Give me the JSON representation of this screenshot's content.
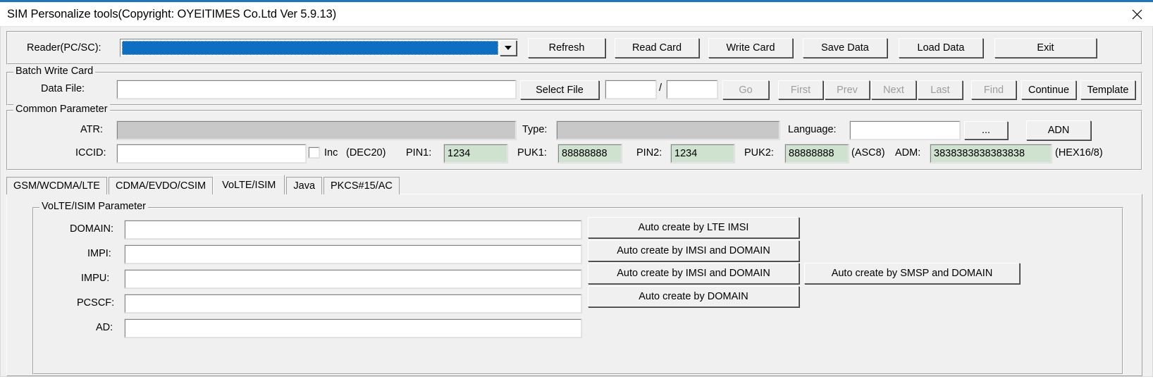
{
  "window": {
    "title": "SIM Personalize tools(Copyright: OYEITIMES Co.Ltd  Ver 5.9.13)",
    "close_icon": "close-icon",
    "accent_color": "#1a78c2",
    "face_color": "#f0f0f0"
  },
  "reader": {
    "label": "Reader(PC/SC):",
    "value": "",
    "dropdown_icon": "chevron-down-icon",
    "selected_color": "#0d6fc4",
    "buttons": [
      {
        "label": "Refresh",
        "enabled": true
      },
      {
        "label": "Read Card",
        "enabled": true
      },
      {
        "label": "Write Card",
        "enabled": true
      },
      {
        "label": "Save Data",
        "enabled": true
      },
      {
        "label": "Load Data",
        "enabled": true
      },
      {
        "label": "Exit",
        "enabled": true
      }
    ]
  },
  "batch": {
    "group_title": "Batch Write Card",
    "data_file_label": "Data File:",
    "data_file_value": "",
    "select_file_label": "Select File",
    "index_current": "",
    "index_separator": "/",
    "index_total": "",
    "nav_buttons": [
      {
        "label": "Go",
        "enabled": false
      },
      {
        "label": "First",
        "enabled": false
      },
      {
        "label": "Prev",
        "enabled": false
      },
      {
        "label": "Next",
        "enabled": false
      },
      {
        "label": "Last",
        "enabled": false
      },
      {
        "label": "Find",
        "enabled": false
      },
      {
        "label": "Continue",
        "enabled": true
      },
      {
        "label": "Template",
        "enabled": true
      }
    ]
  },
  "common": {
    "group_title": "Common Parameter",
    "atr_label": "ATR:",
    "atr_value": "",
    "type_label": "Type:",
    "type_value": "",
    "language_label": "Language:",
    "language_value": "",
    "language_browse_label": "...",
    "adn_label": "ADN",
    "iccid_label": "ICCID:",
    "iccid_value": "",
    "inc_label": "Inc",
    "inc_checked": false,
    "dec20_label": "(DEC20)",
    "pin1_label": "PIN1:",
    "pin1_value": "1234",
    "puk1_label": "PUK1:",
    "puk1_value": "88888888",
    "pin2_label": "PIN2:",
    "pin2_value": "1234",
    "puk2_label": "PUK2:",
    "puk2_value": "88888888",
    "asc8_label": "(ASC8)",
    "adm_label": "ADM:",
    "adm_value": "3838383838383838",
    "hex_label": "(HEX16/8)",
    "value_field_color": "#cfe2cf",
    "readonly_field_color": "#c8c8c8"
  },
  "tabs": [
    {
      "label": "GSM/WCDMA/LTE",
      "active": false
    },
    {
      "label": "CDMA/EVDO/CSIM",
      "active": false
    },
    {
      "label": "VoLTE/ISIM",
      "active": true
    },
    {
      "label": "Java",
      "active": false
    },
    {
      "label": "PKCS#15/AC",
      "active": false
    }
  ],
  "volte": {
    "group_title": "VoLTE/ISIM  Parameter",
    "fields": [
      {
        "label": "DOMAIN:",
        "value": ""
      },
      {
        "label": "IMPI:",
        "value": ""
      },
      {
        "label": "IMPU:",
        "value": ""
      },
      {
        "label": "PCSCF:",
        "value": ""
      },
      {
        "label": "AD:",
        "value": ""
      }
    ],
    "auto_buttons": [
      {
        "label": "Auto create by LTE IMSI"
      },
      {
        "label": "Auto create by IMSI and DOMAIN"
      },
      {
        "label": "Auto create by IMSI and DOMAIN"
      },
      {
        "label": "Auto create by DOMAIN"
      }
    ],
    "smsp_button": {
      "label": "Auto create by SMSP and DOMAIN"
    }
  }
}
